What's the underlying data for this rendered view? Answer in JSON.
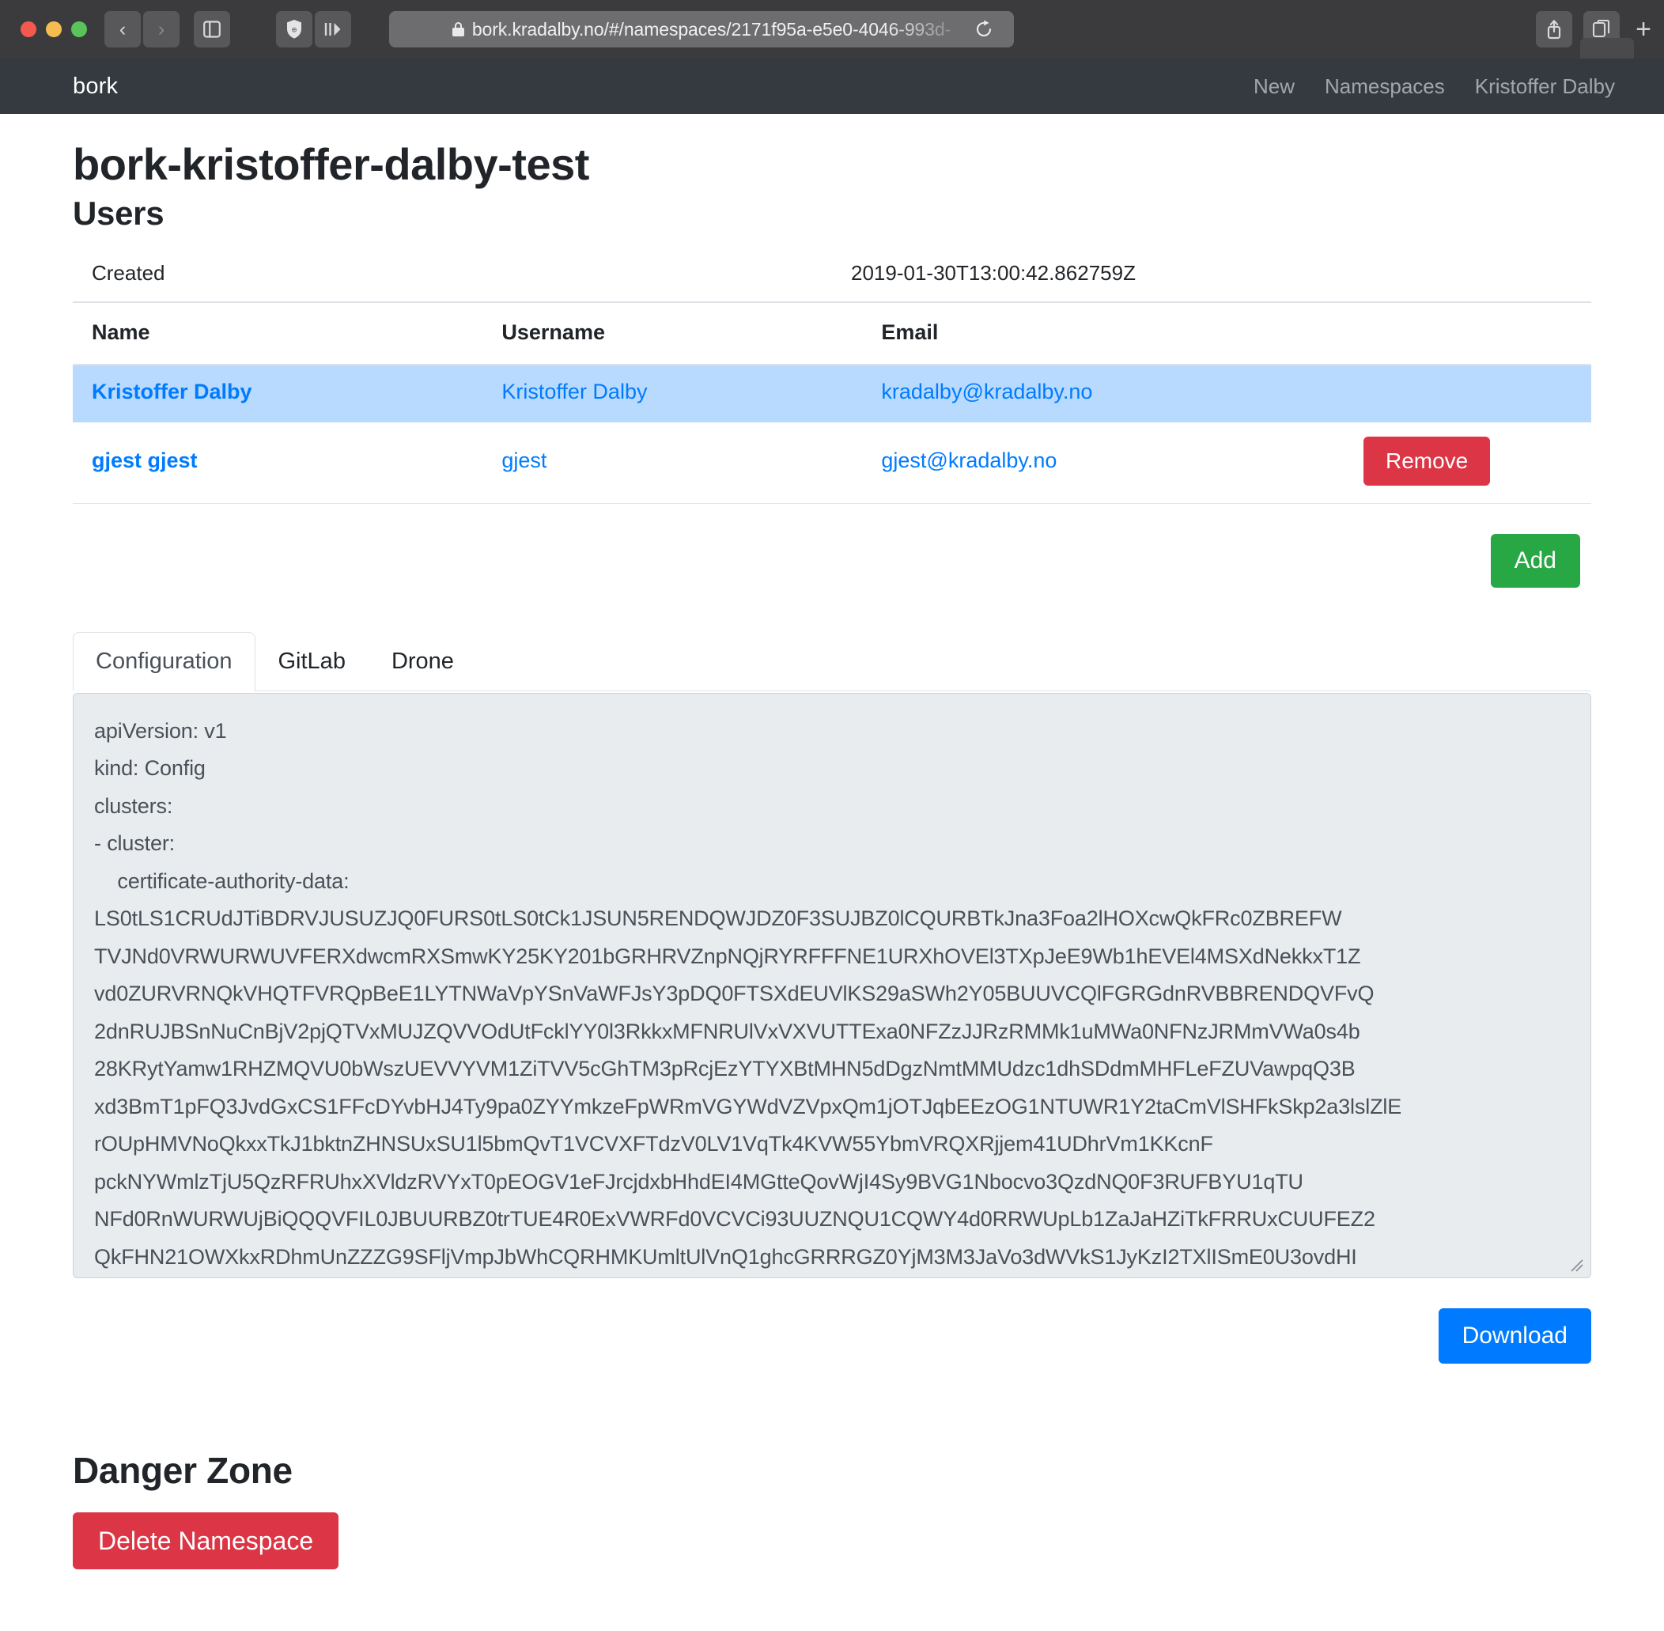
{
  "browser": {
    "url": "bork.kradalby.no/#/namespaces/2171f95a-e5e0-4046-993d-",
    "lock_icon": "lock-icon",
    "back_glyph": "‹",
    "forward_glyph": "›",
    "sidebar_icon": "sidebar-toggle-icon",
    "shield_icon": "shield-icon",
    "reader_icon": "reader-view-icon",
    "share_icon": "share-icon",
    "tabs_icon": "tab-overview-icon",
    "new_tab_glyph": "+"
  },
  "navbar": {
    "brand": "bork",
    "links": [
      {
        "label": "New",
        "name": "nav-link-new"
      },
      {
        "label": "Namespaces",
        "name": "nav-link-namespaces"
      },
      {
        "label": "Kristoffer Dalby",
        "name": "nav-link-user"
      }
    ]
  },
  "page": {
    "title": "bork-kristoffer-dalby-test",
    "users_heading": "Users"
  },
  "meta": {
    "created_label": "Created",
    "created_value": "2019-01-30T13:00:42.862759Z"
  },
  "users": {
    "columns": [
      "Name",
      "Username",
      "Email"
    ],
    "rows": [
      {
        "name": "Kristoffer Dalby",
        "username": "Kristoffer Dalby",
        "email": "kradalby@kradalby.no",
        "action": "",
        "selected": true
      },
      {
        "name": "gjest gjest",
        "username": "gjest",
        "email": "gjest@kradalby.no",
        "action": "Remove",
        "selected": false
      }
    ],
    "add_label": "Add"
  },
  "tabs": [
    {
      "label": "Configuration",
      "active": true
    },
    {
      "label": "GitLab",
      "active": false
    },
    {
      "label": "Drone",
      "active": false
    }
  ],
  "config": {
    "lines": [
      "apiVersion: v1",
      "kind: Config",
      "clusters:",
      "- cluster:",
      "    certificate-authority-data:"
    ],
    "b64": [
      "LS0tLS1CRUdJTiBDRVJUSUZJQ0FURS0tLS0tCk1JSUN5RENDQWJDZ0F3SUJBZ0lCQURBTkJna3Foa2lHOXcwQkFRc0ZBREFW",
      "TVJNd0VRWURWUVFERXdwcmRXSmwKY25KY201bGRHRVZnpNQjRYRFFFNE1URXhOVEl3TXpJeE9Wb1hEVEl4MSXdNekkxT1Z",
      "vd0ZURVRNQkVHQTFVRQpBeE1LYTNWaVpYSnVaWFJsY3pDQ0FTSXdEUVlKS29aSWh2Y05BUUVCQlFGRGdnRVBBRENDQVFvQ",
      "2dnRUJBSnNuCnBjV2pjQTVxMUJZQVVOdUtFcklYY0l3RkkxMFNRUlVxVXVUTTExa0NFZzJJRzRMMk1uMWa0NFNzJRMmVWa0s4b",
      "28KRytYamw1RHZMQVU0bWszUEVVYVM1ZiTVV5cGhTM3pRcjEzYTYXBtMHN5dDgzNmtMMUdzc1dhSDdmMHFLeFZUVawpqQ3B",
      "xd3BmT1pFQ3JvdGxCS1FFcDYvbHJ4Ty9pa0ZYYmkzeFpWRmVGYWdVZVpxQm1jOTJqbEEzOG1NTUWR1Y2taCmVlSHFkSkp2a3lslZlE",
      "rOUpHMVNoQkxxTkJ1bktnZHNSUxSU1l5bmQvT1VCVXFTdzV0LV1VqTk4KVW55YbmVRQXRjjem41UDhrVm1KKcnF",
      "pckNYWmlzTjU5QzRFRUhxXVldzRVYxT0pEOGV1eFJrcjdxbHhdEI4MGtteQovWjI4Sy9BVG1Nbocvo3QzdNQ0F3RUFBYU1qTU",
      "NFd0RnWURWUjBiQQQVFIL0JBUURBZ0trTUE4R0ExVWRFd0VCVCi93UUZNQU1CQWY4d0RRWUpLb1ZaJaHZiTkFRRUxCUUFEZ2",
      "QkFHN21OWXkxRDhmUnZZZG9SFljVmpJbWhCQRHMKUmltUlVnQ1ghcGRRRGZ0YjM3M3JaVo3dWVkS1JyKzI2TXlISmE0U3ovdHI"
    ],
    "resize_grip_icon": "resize-grip-icon"
  },
  "download": {
    "label": "Download"
  },
  "danger": {
    "title": "Danger Zone",
    "delete_label": "Delete Namespace"
  },
  "colors": {
    "navbar_bg": "#343a40",
    "accent_blue": "#007bff",
    "danger_red": "#dc3545",
    "success_green": "#28a745",
    "row_selected": "#b8daff"
  }
}
